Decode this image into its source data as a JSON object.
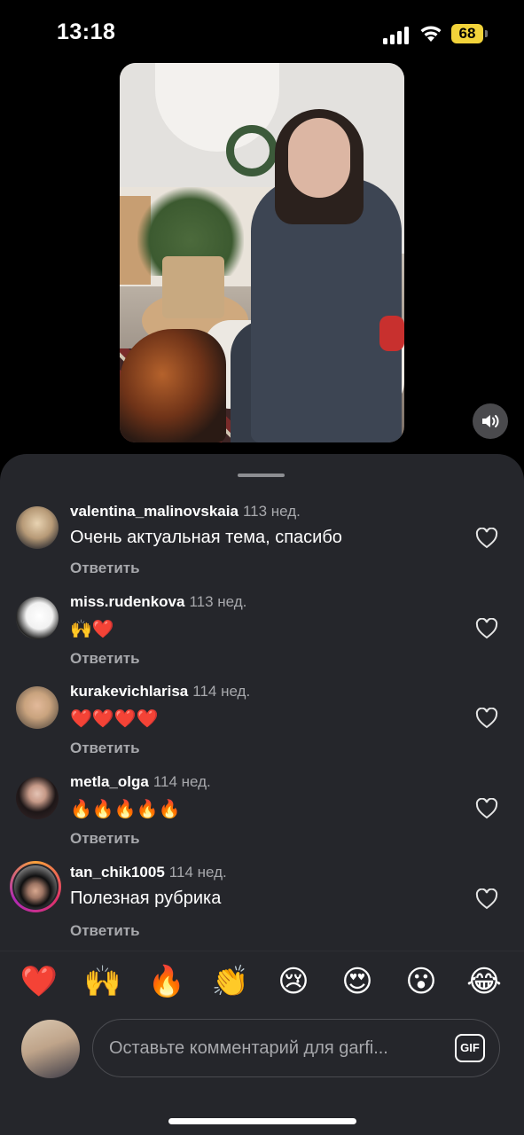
{
  "status_bar": {
    "time": "13:18",
    "battery": "68"
  },
  "video": {
    "sound_icon": "speaker-icon"
  },
  "comments": [
    {
      "username": "valentina_malinovskaia",
      "time": "113 нед.",
      "text": "Очень актуальная тема, спасибо",
      "reply": "Ответить"
    },
    {
      "username": "miss.rudenkova",
      "time": "113 нед.",
      "text": "🙌❤️",
      "reply": "Ответить"
    },
    {
      "username": "kurakevichlarisa",
      "time": "114 нед.",
      "text": "❤️❤️❤️❤️",
      "reply": "Ответить"
    },
    {
      "username": "metla_olga",
      "time": "114 нед.",
      "text": "🔥🔥🔥🔥🔥",
      "reply": "Ответить"
    },
    {
      "username": "tan_chik1005",
      "time": "114 нед.",
      "text": "Полезная рубрика",
      "reply": "Ответить"
    }
  ],
  "emoji_bar": [
    "❤️",
    "🙌",
    "🔥",
    "👏",
    "😢",
    "😍",
    "😮",
    "😂"
  ],
  "composer": {
    "placeholder": "Оставьте комментарий для garfi...",
    "gif_label": "GIF"
  },
  "colors": {
    "sheet_bg": "#25262b",
    "battery": "#f2d33a",
    "like_heart": "#e5e5e5",
    "secondary_text": "#a7a8ac"
  }
}
